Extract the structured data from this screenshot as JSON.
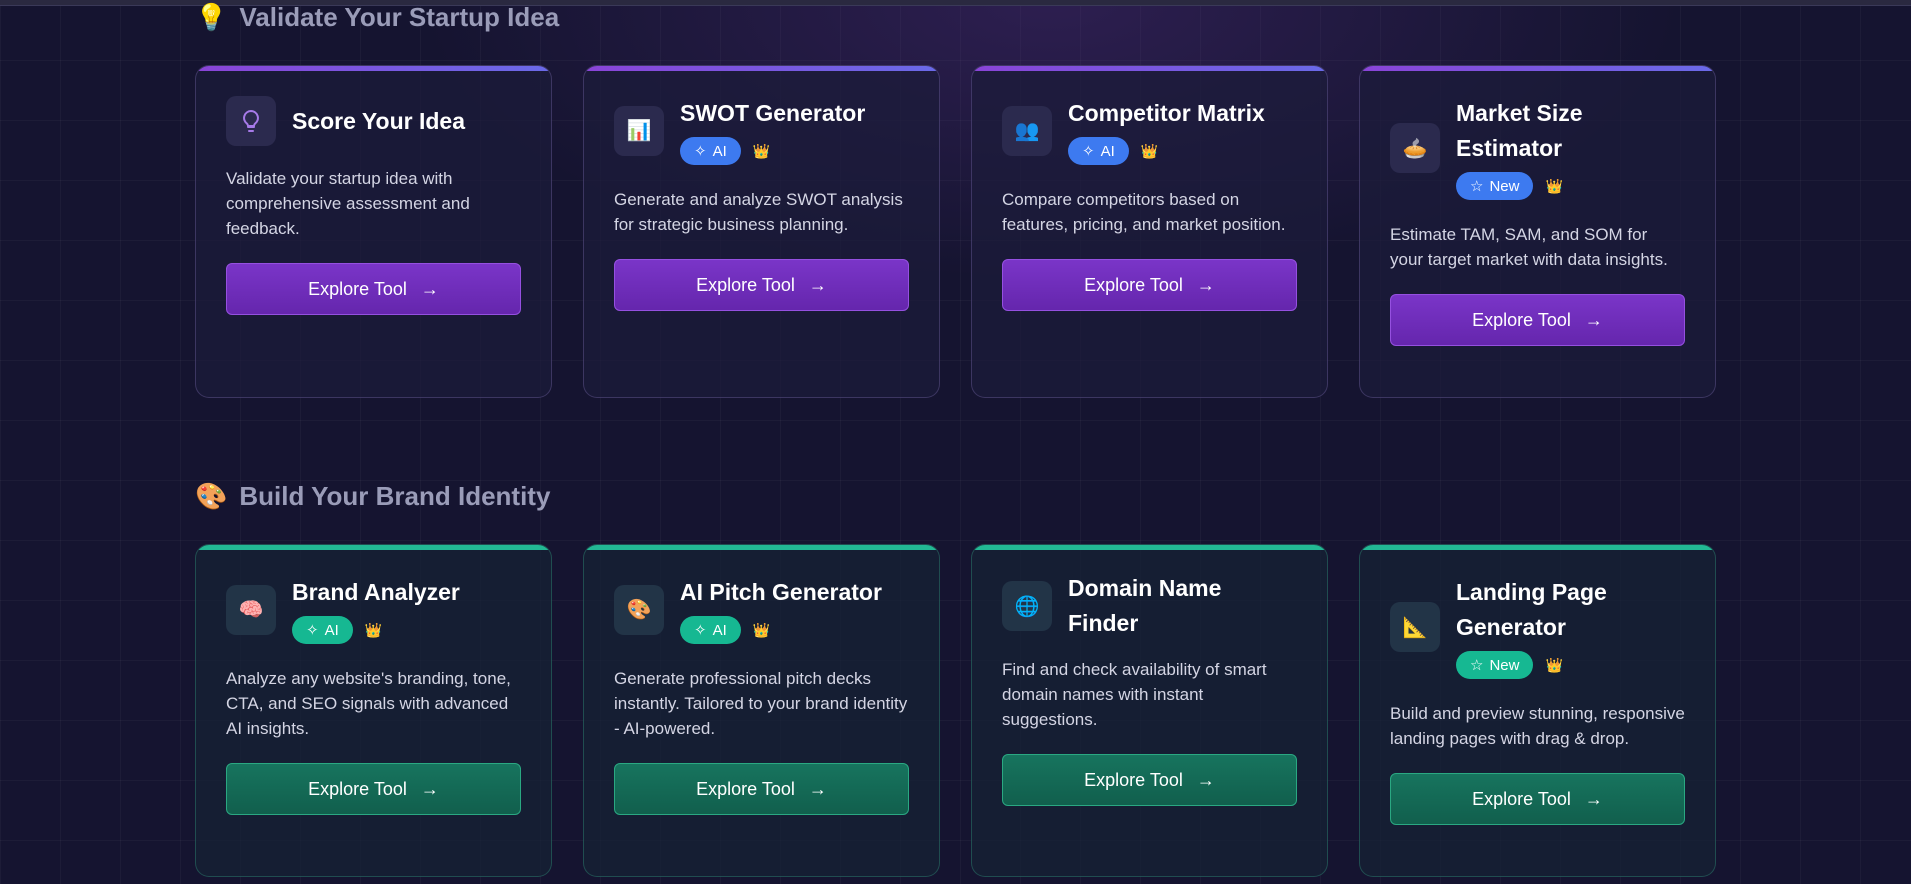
{
  "sections": [
    {
      "emoji": "💡",
      "title": "Validate Your Startup Idea",
      "cards": [
        {
          "icon": "lightbulb-icon",
          "glyph": "",
          "title": "Score Your Idea",
          "badge": "",
          "crown": "",
          "desc": "Validate your startup idea with comprehensive assessment and feedback.",
          "button": "Explore Tool",
          "arrow": "→"
        },
        {
          "icon": "bar-chart-icon",
          "glyph": "📊",
          "title": "SWOT Generator",
          "badge": "AI",
          "crown": "👑",
          "desc": "Generate and analyze SWOT analysis for strategic business planning.",
          "button": "Explore Tool",
          "arrow": "→"
        },
        {
          "icon": "users-icon",
          "glyph": "👥",
          "title": "Competitor Matrix",
          "badge": "AI",
          "crown": "👑",
          "desc": "Compare competitors based on features, pricing, and market position.",
          "button": "Explore Tool",
          "arrow": "→"
        },
        {
          "icon": "pie-icon",
          "glyph": "🥧",
          "title": "Market Size Estimator",
          "badge": "New",
          "crown": "👑",
          "desc": "Estimate TAM, SAM, and SOM for your target market with data insights.",
          "button": "Explore Tool",
          "arrow": "→"
        }
      ]
    },
    {
      "emoji": "🎨",
      "title": "Build Your Brand Identity",
      "cards": [
        {
          "icon": "brain-icon",
          "glyph": "🧠",
          "title": "Brand Analyzer",
          "badge": "AI",
          "crown": "👑",
          "desc": "Analyze any website's branding, tone, CTA, and SEO signals with advanced AI insights.",
          "button": "Explore Tool",
          "arrow": "→"
        },
        {
          "icon": "palette-icon",
          "glyph": "🎨",
          "title": "AI Pitch Generator",
          "badge": "AI",
          "crown": "👑",
          "desc": "Generate professional pitch decks instantly. Tailored to your brand identity - AI-powered.",
          "button": "Explore Tool",
          "arrow": "→"
        },
        {
          "icon": "globe-icon",
          "glyph": "🌐",
          "title": "Domain Name Finder",
          "badge": "",
          "crown": "",
          "desc": "Find and check availability of smart domain names with instant suggestions.",
          "button": "Explore Tool",
          "arrow": "→"
        },
        {
          "icon": "triangle-ruler-icon",
          "glyph": "📐",
          "title": "Landing Page Generator",
          "badge": "New",
          "crown": "👑",
          "desc": "Build and preview stunning, responsive landing pages with drag & drop.",
          "button": "Explore Tool",
          "arrow": "→"
        }
      ]
    }
  ],
  "colors": {
    "purple_accent": "#7a35c8",
    "green_accent": "#17745e",
    "ai_badge_blue": "#3d7af0",
    "ai_badge_teal": "#16b892"
  }
}
